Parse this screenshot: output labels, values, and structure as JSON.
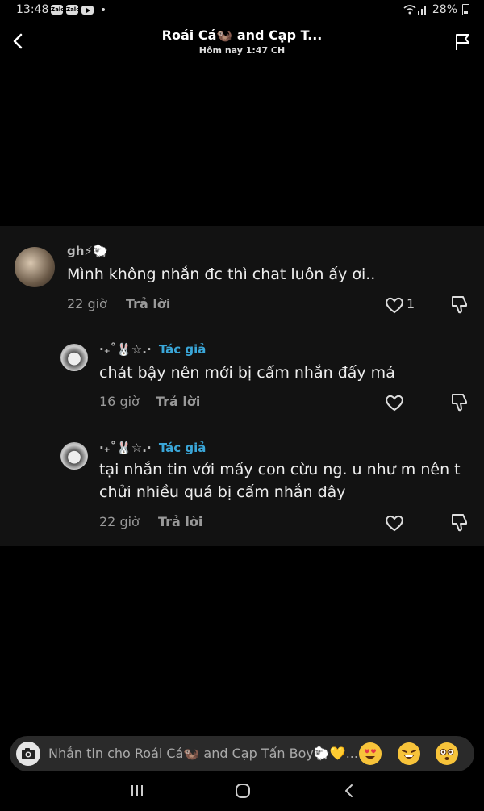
{
  "status": {
    "time": "13:48",
    "app_icon_1": "Zalo",
    "app_icon_2": "Zalo",
    "battery": "28%"
  },
  "header": {
    "title": "Roái Cá🦦 and Cạp T...",
    "subtitle": "Hôm nay 1:47 CH"
  },
  "comments": [
    {
      "user": "gh⚡🐑",
      "text": "Mình không nhắn đc thì chat luôn ấy ơi..",
      "time": "22 giờ",
      "reply": "Trả lời",
      "likes": "1"
    },
    {
      "user": "·₊˚🐰☆.·",
      "author": "Tác giả",
      "text": "chát bậy nên mới bị cấm nhắn đấy má",
      "time": "16 giờ",
      "reply": "Trả lời"
    },
    {
      "user": "·₊˚🐰☆.·",
      "author": "Tác giả",
      "text_line1": "tại nhắn tin với mấy con cừu ng. u như m nên t",
      "text_line2": "chửi nhiều quá bị cấm nhắn đây",
      "time": "22 giờ",
      "reply": "Trả lời"
    }
  ],
  "composer": {
    "placeholder": "Nhắn tin cho Roái Cá🦦 and Cạp Tấn Boy🐑💛..."
  },
  "icons": [
    "back-icon",
    "flag-icon",
    "heart-icon",
    "dislike-icon",
    "camera-icon",
    "heart-eyes-emoji",
    "laugh-emoji",
    "shocked-emoji",
    "recents-icon",
    "home-icon",
    "back-nav-icon"
  ]
}
